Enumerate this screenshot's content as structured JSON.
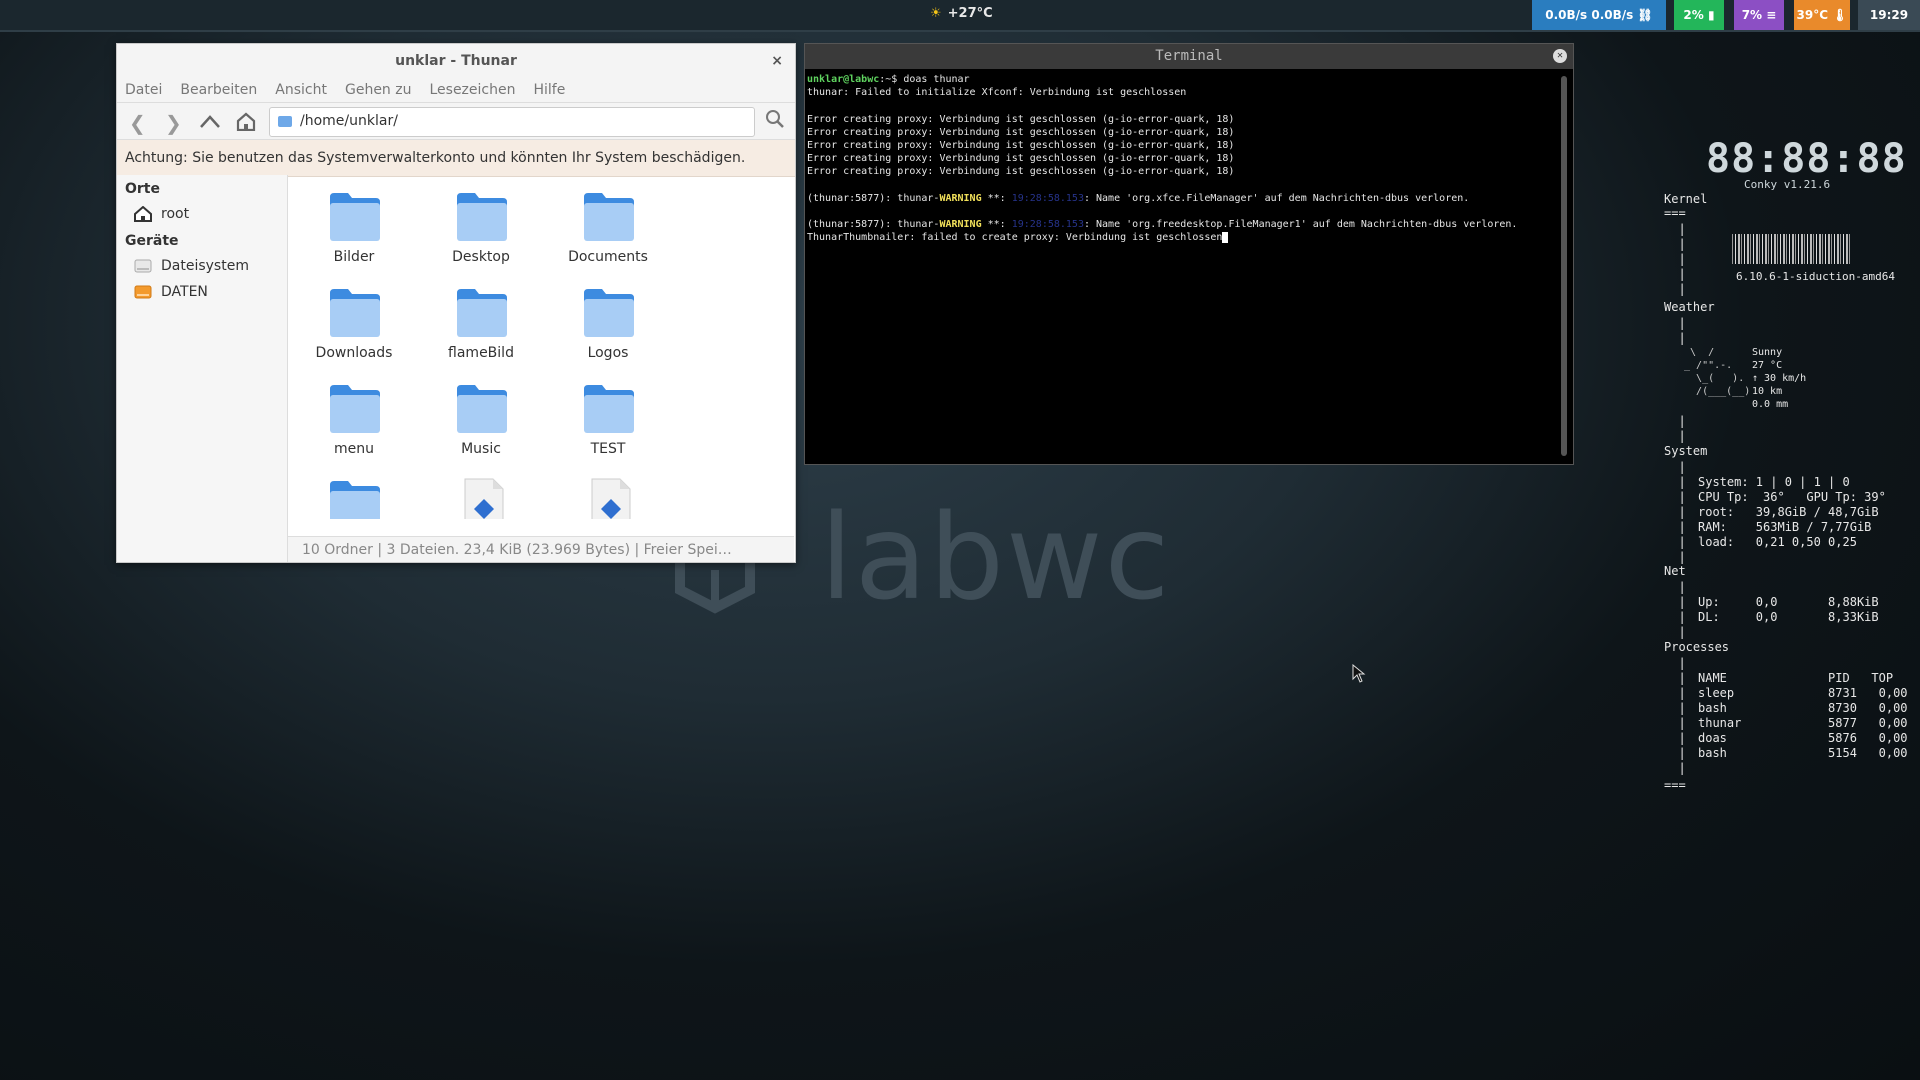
{
  "topbar": {
    "weather": "+27°C",
    "net": "0.0B/s  0.0B/s",
    "battery": "2%",
    "memory": "7%",
    "temp": "39°C",
    "clock": "19:29"
  },
  "desktop": {
    "logo_text": "labwc"
  },
  "thunar": {
    "title": "unklar - Thunar",
    "close": "×",
    "menu": [
      "Datei",
      "Bearbeiten",
      "Ansicht",
      "Gehen zu",
      "Lesezeichen",
      "Hilfe"
    ],
    "path": "/home/unklar/",
    "warning": "Achtung: Sie benutzen das Systemverwalterkonto und könnten Ihr System beschädigen.",
    "sidebar": {
      "places_header": "Orte",
      "places": [
        {
          "label": "root",
          "icon": "home-icon"
        }
      ],
      "devices_header": "Geräte",
      "devices": [
        {
          "label": "Dateisystem",
          "icon": "drive-icon"
        },
        {
          "label": "DATEN",
          "icon": "disk-icon"
        }
      ]
    },
    "files": [
      {
        "name": "Bilder",
        "type": "folder"
      },
      {
        "name": "Desktop",
        "type": "folder"
      },
      {
        "name": "Documents",
        "type": "folder"
      },
      {
        "name": "Downloads",
        "type": "folder"
      },
      {
        "name": "flameBild",
        "type": "folder"
      },
      {
        "name": "Logos",
        "type": "folder"
      },
      {
        "name": "menu",
        "type": "folder"
      },
      {
        "name": "Music",
        "type": "folder"
      },
      {
        "name": "TEST",
        "type": "folder"
      },
      {
        "name": "",
        "type": "folder"
      },
      {
        "name": "",
        "type": "file"
      },
      {
        "name": "",
        "type": "file"
      }
    ],
    "status": "10 Ordner  |  3 Dateien. 23,4 KiB (23.969 Bytes)  |  Freier Spei…"
  },
  "terminal": {
    "title": "Terminal",
    "prompt_user": "unklar@labwc",
    "prompt_rest": ":~$ doas thunar",
    "lines": [
      "thunar: Failed to initialize Xfconf: Verbindung ist geschlossen",
      "",
      "Error creating proxy: Verbindung ist geschlossen (g-io-error-quark, 18)",
      "Error creating proxy: Verbindung ist geschlossen (g-io-error-quark, 18)",
      "Error creating proxy: Verbindung ist geschlossen (g-io-error-quark, 18)",
      "Error creating proxy: Verbindung ist geschlossen (g-io-error-quark, 18)",
      "Error creating proxy: Verbindung ist geschlossen (g-io-error-quark, 18)",
      ""
    ],
    "warn1_pre": "(thunar:5877): thunar-",
    "warn_word": "WARNING",
    "warn1_mid": " **: ",
    "warn1_ts": "19:28:58.153",
    "warn1_post": ": Name 'org.xfce.FileManager' auf dem Nachrichten-dbus verloren.",
    "warn2_ts": "19:28:58.153",
    "warn2_post": ": Name 'org.freedesktop.FileManager1' auf dem Nachrichten-dbus verloren.",
    "last_line": "ThunarThumbnailer: failed to create proxy: Verbindung ist geschlossen"
  },
  "conky": {
    "clock": "88:88:88",
    "version": "Conky v1.21.6",
    "kernel_header": "Kernel",
    "kernel_version": "6.10.6-1-siduction-amd64",
    "weather_header": "Weather",
    "weather_art": [
      "  \\  /    ",
      " _ /\"\".-.  ",
      "   \\_(   ).",
      "   /(___(__)",
      "           "
    ],
    "weather_info": [
      "Sunny",
      "27 °C",
      "↑ 30 km/h",
      "10 km",
      "0.0 mm"
    ],
    "system_header": "System",
    "system_lines": [
      "System: 1 | 0 | 1 | 0",
      "CPU Tp:  36°   GPU Tp: 39°",
      "root:   39,8GiB / 48,7GiB",
      "RAM:    563MiB / 7,77GiB",
      "load:   0,21 0,50 0,25"
    ],
    "net_header": "Net",
    "net_lines": [
      "Up:     0,0       8,88KiB",
      "DL:     0,0       8,33KiB"
    ],
    "processes_header": "Processes",
    "proc_columns": "NAME              PID   TOP",
    "processes": [
      "sleep             8731   0,00",
      "bash              8730   0,00",
      "thunar            5877   0,00",
      "doas              5876   0,00",
      "bash              5154   0,00"
    ],
    "separator": "==="
  }
}
